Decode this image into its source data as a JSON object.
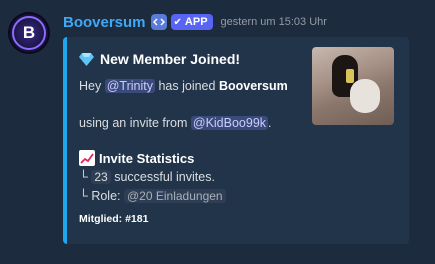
{
  "message": {
    "author": "Booversum",
    "avatar_letter": "B",
    "badge": "APP",
    "timestamp": "gestern um 15:03 Uhr"
  },
  "embed": {
    "accent_color": "#1ea7ee",
    "title": "New Member Joined!",
    "title_icon": "gem-icon",
    "line1": {
      "prefix": "Hey",
      "mention": "@Trinity",
      "middle": "has joined",
      "server": "Booversum"
    },
    "line2": {
      "prefix": "using an invite from",
      "mention": "@KidBoo99k",
      "suffix": "."
    },
    "stats": {
      "icon": "chart-increasing-icon",
      "title": "Invite Statistics",
      "invites_prefix": "└",
      "invites_count": "23",
      "invites_suffix": "successful invites.",
      "role_prefix": "└ Role:",
      "role_value": "@20 Einladungen"
    },
    "footer": "Mitglied: #181"
  }
}
